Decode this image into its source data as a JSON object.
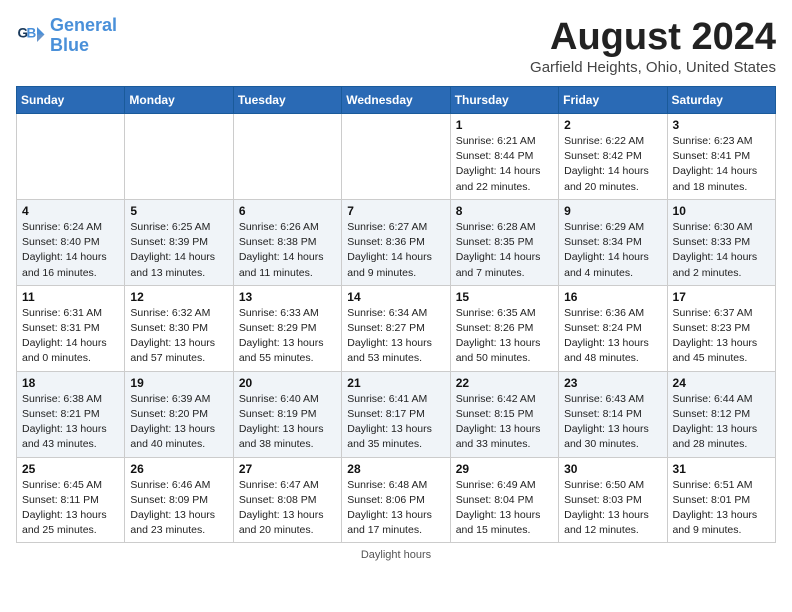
{
  "header": {
    "logo_line1": "General",
    "logo_line2": "Blue",
    "title": "August 2024",
    "subtitle": "Garfield Heights, Ohio, United States"
  },
  "weekdays": [
    "Sunday",
    "Monday",
    "Tuesday",
    "Wednesday",
    "Thursday",
    "Friday",
    "Saturday"
  ],
  "weeks": [
    [
      {
        "day": "",
        "info": ""
      },
      {
        "day": "",
        "info": ""
      },
      {
        "day": "",
        "info": ""
      },
      {
        "day": "",
        "info": ""
      },
      {
        "day": "1",
        "info": "Sunrise: 6:21 AM\nSunset: 8:44 PM\nDaylight: 14 hours and 22 minutes."
      },
      {
        "day": "2",
        "info": "Sunrise: 6:22 AM\nSunset: 8:42 PM\nDaylight: 14 hours and 20 minutes."
      },
      {
        "day": "3",
        "info": "Sunrise: 6:23 AM\nSunset: 8:41 PM\nDaylight: 14 hours and 18 minutes."
      }
    ],
    [
      {
        "day": "4",
        "info": "Sunrise: 6:24 AM\nSunset: 8:40 PM\nDaylight: 14 hours and 16 minutes."
      },
      {
        "day": "5",
        "info": "Sunrise: 6:25 AM\nSunset: 8:39 PM\nDaylight: 14 hours and 13 minutes."
      },
      {
        "day": "6",
        "info": "Sunrise: 6:26 AM\nSunset: 8:38 PM\nDaylight: 14 hours and 11 minutes."
      },
      {
        "day": "7",
        "info": "Sunrise: 6:27 AM\nSunset: 8:36 PM\nDaylight: 14 hours and 9 minutes."
      },
      {
        "day": "8",
        "info": "Sunrise: 6:28 AM\nSunset: 8:35 PM\nDaylight: 14 hours and 7 minutes."
      },
      {
        "day": "9",
        "info": "Sunrise: 6:29 AM\nSunset: 8:34 PM\nDaylight: 14 hours and 4 minutes."
      },
      {
        "day": "10",
        "info": "Sunrise: 6:30 AM\nSunset: 8:33 PM\nDaylight: 14 hours and 2 minutes."
      }
    ],
    [
      {
        "day": "11",
        "info": "Sunrise: 6:31 AM\nSunset: 8:31 PM\nDaylight: 14 hours and 0 minutes."
      },
      {
        "day": "12",
        "info": "Sunrise: 6:32 AM\nSunset: 8:30 PM\nDaylight: 13 hours and 57 minutes."
      },
      {
        "day": "13",
        "info": "Sunrise: 6:33 AM\nSunset: 8:29 PM\nDaylight: 13 hours and 55 minutes."
      },
      {
        "day": "14",
        "info": "Sunrise: 6:34 AM\nSunset: 8:27 PM\nDaylight: 13 hours and 53 minutes."
      },
      {
        "day": "15",
        "info": "Sunrise: 6:35 AM\nSunset: 8:26 PM\nDaylight: 13 hours and 50 minutes."
      },
      {
        "day": "16",
        "info": "Sunrise: 6:36 AM\nSunset: 8:24 PM\nDaylight: 13 hours and 48 minutes."
      },
      {
        "day": "17",
        "info": "Sunrise: 6:37 AM\nSunset: 8:23 PM\nDaylight: 13 hours and 45 minutes."
      }
    ],
    [
      {
        "day": "18",
        "info": "Sunrise: 6:38 AM\nSunset: 8:21 PM\nDaylight: 13 hours and 43 minutes."
      },
      {
        "day": "19",
        "info": "Sunrise: 6:39 AM\nSunset: 8:20 PM\nDaylight: 13 hours and 40 minutes."
      },
      {
        "day": "20",
        "info": "Sunrise: 6:40 AM\nSunset: 8:19 PM\nDaylight: 13 hours and 38 minutes."
      },
      {
        "day": "21",
        "info": "Sunrise: 6:41 AM\nSunset: 8:17 PM\nDaylight: 13 hours and 35 minutes."
      },
      {
        "day": "22",
        "info": "Sunrise: 6:42 AM\nSunset: 8:15 PM\nDaylight: 13 hours and 33 minutes."
      },
      {
        "day": "23",
        "info": "Sunrise: 6:43 AM\nSunset: 8:14 PM\nDaylight: 13 hours and 30 minutes."
      },
      {
        "day": "24",
        "info": "Sunrise: 6:44 AM\nSunset: 8:12 PM\nDaylight: 13 hours and 28 minutes."
      }
    ],
    [
      {
        "day": "25",
        "info": "Sunrise: 6:45 AM\nSunset: 8:11 PM\nDaylight: 13 hours and 25 minutes."
      },
      {
        "day": "26",
        "info": "Sunrise: 6:46 AM\nSunset: 8:09 PM\nDaylight: 13 hours and 23 minutes."
      },
      {
        "day": "27",
        "info": "Sunrise: 6:47 AM\nSunset: 8:08 PM\nDaylight: 13 hours and 20 minutes."
      },
      {
        "day": "28",
        "info": "Sunrise: 6:48 AM\nSunset: 8:06 PM\nDaylight: 13 hours and 17 minutes."
      },
      {
        "day": "29",
        "info": "Sunrise: 6:49 AM\nSunset: 8:04 PM\nDaylight: 13 hours and 15 minutes."
      },
      {
        "day": "30",
        "info": "Sunrise: 6:50 AM\nSunset: 8:03 PM\nDaylight: 13 hours and 12 minutes."
      },
      {
        "day": "31",
        "info": "Sunrise: 6:51 AM\nSunset: 8:01 PM\nDaylight: 13 hours and 9 minutes."
      }
    ]
  ],
  "footer": "Daylight hours"
}
